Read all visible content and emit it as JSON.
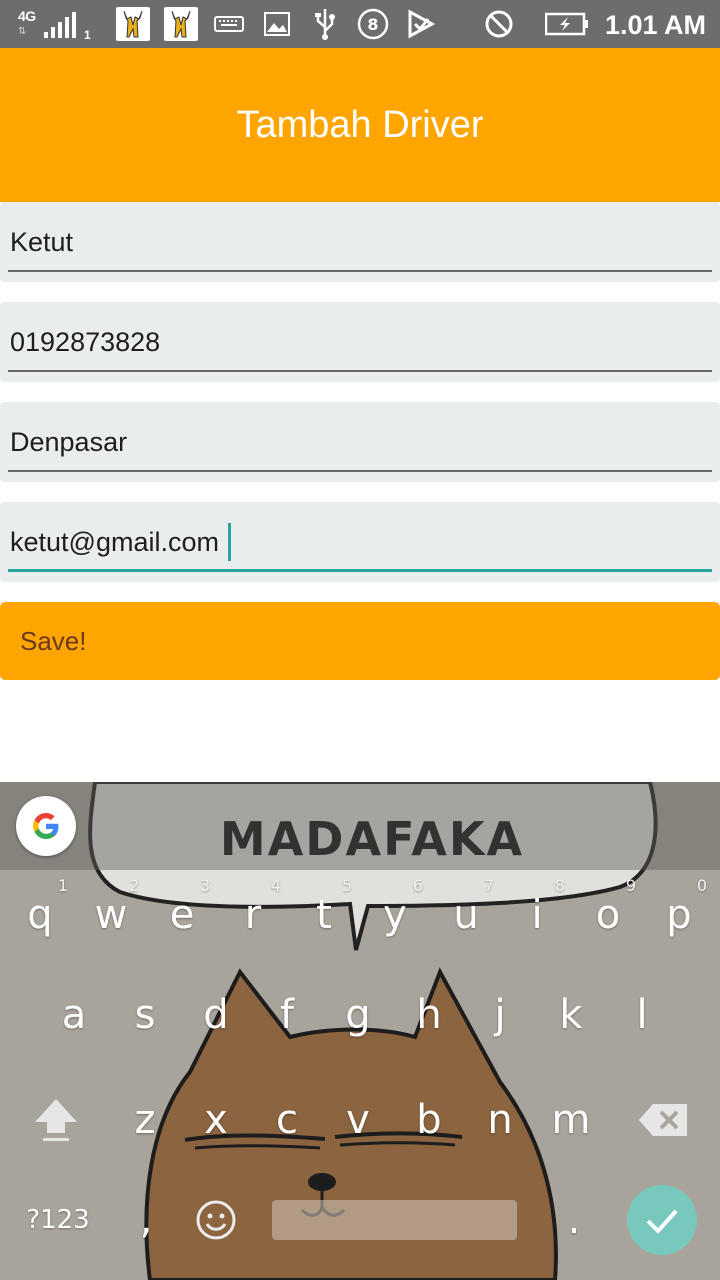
{
  "status_bar": {
    "network_type": "4G",
    "sim_slot": "1",
    "time": "1.01 AM",
    "icons": [
      "signal-icon",
      "app-deer-icon",
      "app-deer-icon",
      "keyboard-icon",
      "image-icon",
      "usb-icon",
      "notification-8-icon",
      "play-store-icon",
      "do-not-disturb-icon",
      "battery-charging-icon"
    ]
  },
  "app_bar": {
    "title": "Tambah Driver"
  },
  "form": {
    "name_value": "Ketut",
    "phone_value": "0192873828",
    "city_value": "Denpasar",
    "email_value": "ketut@gmail.com",
    "save_label": "Save!"
  },
  "keyboard": {
    "suggestion_text": "MADAFAKA",
    "row1": [
      {
        "key": "q",
        "hint": "1"
      },
      {
        "key": "w",
        "hint": "2"
      },
      {
        "key": "e",
        "hint": "3"
      },
      {
        "key": "r",
        "hint": "4"
      },
      {
        "key": "t",
        "hint": "5"
      },
      {
        "key": "y",
        "hint": "6"
      },
      {
        "key": "u",
        "hint": "7"
      },
      {
        "key": "i",
        "hint": "8"
      },
      {
        "key": "o",
        "hint": "9"
      },
      {
        "key": "p",
        "hint": "0"
      }
    ],
    "row2": [
      "a",
      "s",
      "d",
      "f",
      "g",
      "h",
      "j",
      "k",
      "l"
    ],
    "row3": [
      "z",
      "x",
      "c",
      "v",
      "b",
      "n",
      "m"
    ],
    "symbols_label": "?123",
    "comma": ",",
    "period": ".",
    "enter_color": "#78c8bd"
  },
  "colors": {
    "accent": "#ffa500",
    "status_bar": "#6d6d6d",
    "field_bg": "#eaedee",
    "focus": "#26a69a"
  }
}
